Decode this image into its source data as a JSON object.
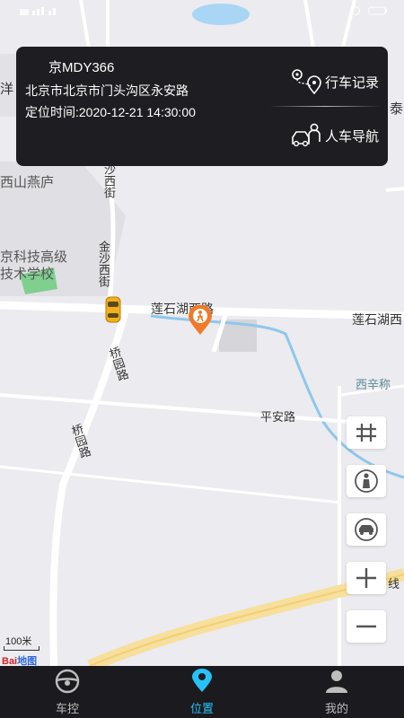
{
  "colors": {
    "accent": "#27c2f5",
    "card_bg": "#1e1e22",
    "tab_bg": "#1b1b1f",
    "route": "#f7df9c",
    "river": "#8dc8ea"
  },
  "card": {
    "plate": "京MDY366",
    "address": "北京市北京市门头沟区永安路",
    "location_time": "定位时间:2020-12-21 14:30:00",
    "btn_records": "行车记录",
    "btn_navigation": "人车导航"
  },
  "map": {
    "labels": {
      "yang": "洋",
      "tai": "泰",
      "xishan": "西山燕庐",
      "school_1": "京科技高级",
      "school_2": "技术学校",
      "jinsha_top": "沙西街",
      "jinsha_mid": "金沙西街",
      "lianshi_1": "莲石湖西路",
      "lianshi_2": "莲石湖西",
      "qiaoyuan_1": "桥园路",
      "qiaoyuan_2": "桥园路",
      "xixin": "西辛称",
      "pingan": "平安路",
      "xian": "线"
    },
    "scale": "100米",
    "logo": "Bai地图"
  },
  "controls": [
    "grid-icon",
    "person-icon",
    "car-icon",
    "zoom-in-icon",
    "zoom-out-icon"
  ],
  "tabs": [
    {
      "label": "车控",
      "icon": "steering-wheel-icon",
      "active": false
    },
    {
      "label": "位置",
      "icon": "location-pin-icon",
      "active": true
    },
    {
      "label": "我的",
      "icon": "profile-icon",
      "active": false
    }
  ]
}
